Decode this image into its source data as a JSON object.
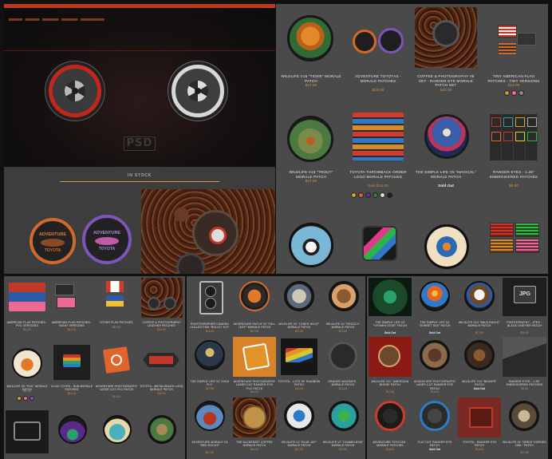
{
  "hero": {
    "logo": "PSD",
    "in_stock_label": "IN STOCK",
    "promo_lettering_1": "ADVENTURE",
    "promo_lettering_2": "TOYOTA"
  },
  "grid_main": [
    {
      "title": "WILDLIFE V15 \"TIGER\" MORALE PATCH",
      "price": "$17.50"
    },
    {
      "title": "ADVENTURE TOYOTAS - MORALE PATCHES",
      "price": "$16.00"
    },
    {
      "title": "COFFEE & PHOTOGRAPHY V8 SET - RANGER EYE MORALE PATCH SET",
      "price": "$20.00"
    },
    {
      "title": "TINY AMERICAN FLAG PATCHES - TINY VERSIONS",
      "price": "$12.00"
    },
    {
      "title": "WILDLIFE V16 \"TROUT\" MORALE PATCH",
      "price": "$17.50"
    },
    {
      "title": "TOYOTA THROWBACK ORDER LOGO MORALE PATCHES",
      "price": "from $14.00"
    },
    {
      "title": "THE SIMPLE LIFE V5 \"MAGICAL\" MORALE PATCH",
      "price": "Sold Out"
    },
    {
      "title": "RANGER EYES - 1.25\" EMBROIDERED PATCHES",
      "price": "$9.00"
    }
  ],
  "grid_left": [
    {
      "title": "AMERICAN FLAG PATCHES - PVC VERSIONS",
      "price": "$12.00"
    },
    {
      "title": "AMERICAN FLAG PATCHES - NIGHT VERSIONS",
      "price": "$12.00"
    },
    {
      "title": "OTHER FLAG PATCHES",
      "price": "$12.00"
    },
    {
      "title": "COFFEE & PHOTOGRAPHY LEATHER PATCHES",
      "price": "$14.00"
    },
    {
      "title": "WILDLIFE V5 \"FOX\" MORALE PATCH",
      "price": "$17.50"
    },
    {
      "title": "CLICK TOTES - SUN MORALE PATCHES",
      "price": "$14.00"
    },
    {
      "title": "ADVENTURE PHOTOGRAPHY LASER CUT PVC PATCH",
      "price": "$14.00"
    },
    {
      "title": "TOYOTA - METALHEADS LONG MORALE PATCH",
      "price": "$16.00"
    }
  ],
  "grid_mid": [
    {
      "title": "PHOTOGRAPHER CAMERA COLLECTION \"ROLLEI TLR\"",
      "price": "$14.00"
    },
    {
      "title": "ADVENTURE PATCH V2 \"FALL LEAF\" MORALE PATCH",
      "price": "$17.50"
    },
    {
      "title": "WILDLIFE V3 \"LONER WOLF\" MORALE PATCH",
      "price": "$17.50"
    },
    {
      "title": "WILDLIFE V4 \"GRIZZLY\" MORALE PATCH",
      "price": "$17.50"
    },
    {
      "title": "THE SIMPLE LIFE V2 \"HIGH FLY\"",
      "price": "$17.50"
    },
    {
      "title": "ADVENTURE PHOTOGRAPHY LASER CUT RANGER EYE PVC PATCH",
      "price": "$14.00"
    },
    {
      "title": "TOYOTA - LOTS OF RAINBOW PATCH",
      "price": "$14.00"
    },
    {
      "title": "ORANGE MAGSAFE - MORALE PATCH",
      "price": "$16.00"
    },
    {
      "title": "ADVENTURE MORALE V3 \"RED ROCKS\"",
      "price": "$17.50"
    },
    {
      "title": "THE ALCHEMIST COFFEE MORALE PATCH",
      "price": "$14.00"
    },
    {
      "title": "WILDLIFE V2 \"BLUE JAY\" MORALE PATCH",
      "price": "$17.50"
    },
    {
      "title": "WILDLIFE V7 \"CHAMELEON\" MORALE PATCH",
      "price": "$17.50"
    }
  ],
  "grid_right": [
    {
      "title": "THE SIMPLE LIFE V3 \"VITAMIN DOSE\" PATCH",
      "price": "Sold Out"
    },
    {
      "title": "THE SIMPLE LIFE V4 \"SUNSET SEA\" PATCH",
      "price": "Sold Out"
    },
    {
      "title": "WILDLIFE V14 \"BALD EAGLE\" MORALE PATCH",
      "price": "$17.50"
    },
    {
      "title": "PHOTOGRAPHY - JPEG - BLACK LEATHER PATCH",
      "price": "$14.00"
    },
    {
      "title": "WILDLIFE V11 \"AMERICAN BISON\" PATCH",
      "price": "$17.50"
    },
    {
      "title": "ADVENTURE PHOTOGRAPHY LASER CUT RANGER EYE PATCH",
      "price": "$14.00"
    },
    {
      "title": "WILDLIFE V13 \"BEAVER\" PATCH",
      "price": "Sold Out"
    },
    {
      "title": "RANGER EYES - 1.25\" EMBROIDERED PATCHES",
      "price": "$9.00"
    },
    {
      "title": "ADVENTURE TOYOTAS - MORALE PATCHES",
      "price": "$16.00"
    },
    {
      "title": "FLAT CUT RANGER EYE PATCH",
      "price": "Sold Out"
    },
    {
      "title": "TOYOTA - RANGER EYE PATCH",
      "price": "$14.00"
    },
    {
      "title": "WILDLIFE V1 \"GREAT HORNED OWL\" PATCH",
      "price": "$17.50"
    }
  ]
}
